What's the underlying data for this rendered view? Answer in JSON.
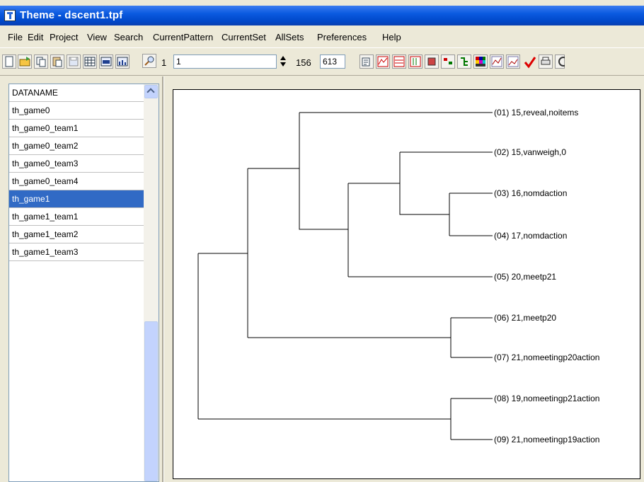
{
  "window": {
    "title": "Theme - dscent1.tpf"
  },
  "menu": [
    "File",
    "Edit",
    "Project",
    "View",
    "Search",
    "CurrentPattern",
    "CurrentSet",
    "AllSets",
    "Preferences",
    "Help"
  ],
  "toolbar": {
    "counter_start": "1",
    "current_value": "1",
    "counter_total": "156",
    "total_value": "613",
    "icons": [
      "new-file-icon",
      "open-folder-icon",
      "copy-icon",
      "paste-icon",
      "save-icon",
      "table-icon",
      "grid-icon",
      "chart-icon",
      "search-icon",
      "clipboard-icon",
      "pattern-view-icon",
      "pattern-compare-icon",
      "sequence-icon",
      "tool-icon",
      "arrange-icon",
      "tree-icon",
      "color-grid-icon",
      "line-chart-icon",
      "area-chart-icon",
      "check-icon",
      "print-icon",
      "more-icon"
    ]
  },
  "datalist": {
    "header": "DATANAME",
    "items": [
      "th_game0",
      "th_game0_team1",
      "th_game0_team2",
      "th_game0_team3",
      "th_game0_team4",
      "th_game1",
      "th_game1_team1",
      "th_game1_team2",
      "th_game1_team3"
    ],
    "selected_index": 5
  },
  "dendrogram": {
    "leaves": [
      "(01) 15,reveal,noitems",
      "(02) 15,vanweigh,0",
      "(03) 16,nomdaction",
      "(04) 17,nomdaction",
      "(05) 20,meetp21",
      "(06) 21,meetp20",
      "(07) 21,nomeetingp20action",
      "(08) 19,nomeetingp21action",
      "(09) 21,nomeetingp19action"
    ]
  }
}
